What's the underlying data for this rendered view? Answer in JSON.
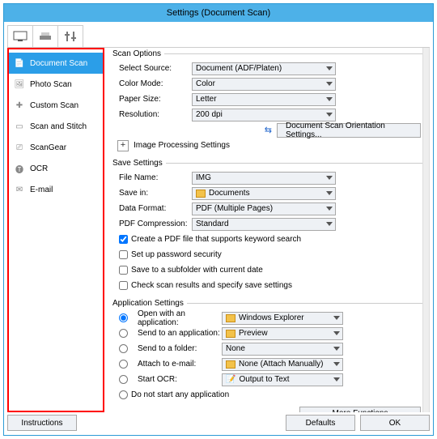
{
  "title": "Settings (Document Scan)",
  "sidebar": {
    "items": [
      {
        "label": "Document Scan"
      },
      {
        "label": "Photo Scan"
      },
      {
        "label": "Custom Scan"
      },
      {
        "label": "Scan and Stitch"
      },
      {
        "label": "ScanGear"
      },
      {
        "label": "OCR"
      },
      {
        "label": "E-mail"
      }
    ]
  },
  "scan": {
    "legend": "Scan Options",
    "source_lbl": "Select Source:",
    "source_val": "Document (ADF/Platen)",
    "color_lbl": "Color Mode:",
    "color_val": "Color",
    "paper_lbl": "Paper Size:",
    "paper_val": "Letter",
    "res_lbl": "Resolution:",
    "res_val": "200 dpi",
    "orient_btn": "Document Scan Orientation Settings...",
    "img_proc": "Image Processing Settings"
  },
  "save": {
    "legend": "Save Settings",
    "file_lbl": "File Name:",
    "file_val": "IMG",
    "savein_lbl": "Save in:",
    "savein_val": "Documents",
    "fmt_lbl": "Data Format:",
    "fmt_val": "PDF (Multiple Pages)",
    "comp_lbl": "PDF Compression:",
    "comp_val": "Standard",
    "chk1": "Create a PDF file that supports keyword search",
    "chk2": "Set up password security",
    "chk3": "Save to a subfolder with current date",
    "chk4": "Check scan results and specify save settings"
  },
  "app": {
    "legend": "Application Settings",
    "r1": "Open with an application:",
    "r1v": "Windows Explorer",
    "r2": "Send to an application:",
    "r2v": "Preview",
    "r3": "Send to a folder:",
    "r3v": "None",
    "r4": "Attach to e-mail:",
    "r4v": "None (Attach Manually)",
    "r5": "Start OCR:",
    "r5v": "Output to Text",
    "r6": "Do not start any application",
    "more": "More Functions"
  },
  "footer": {
    "instr": "Instructions",
    "def": "Defaults",
    "ok": "OK"
  }
}
